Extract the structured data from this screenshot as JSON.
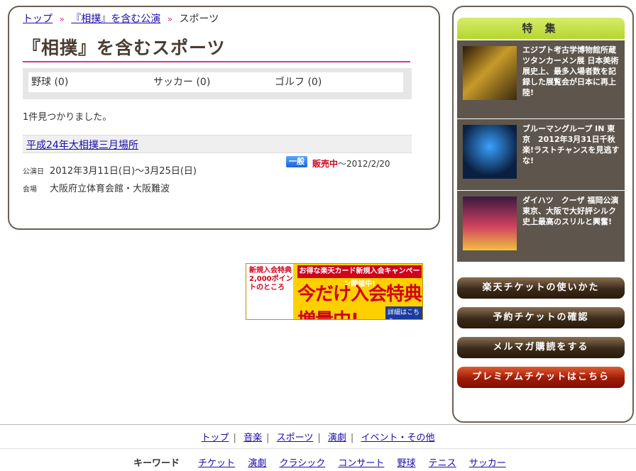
{
  "breadcrumb": {
    "items": [
      "トップ",
      "『相撲』を含む公演",
      "スポーツ"
    ],
    "separator": "»"
  },
  "page_title": "『相撲』を含むスポーツ",
  "categories": [
    {
      "label": "野球 (0)"
    },
    {
      "label": "サッカー (0)"
    },
    {
      "label": "ゴルフ (0)"
    }
  ],
  "result_count": "1件見つかりました。",
  "event": {
    "title": "平成24年大相撲三月場所",
    "date_label": "公演日",
    "date_value": "2012年3月11日(日)〜3月25日(日)",
    "venue_label": "会場",
    "venue_value": "大阪府立体育会館・大阪難波",
    "badge": "一般",
    "sale_status": "販売中",
    "sale_until": "〜2012/2/20"
  },
  "banner": {
    "left_text": "新規入会特典2,000ポイントのところ",
    "top_text": "お得な楽天カード新規入会キャンペーン開催中!",
    "main_text": "今だけ入会特典増量中!",
    "detail": "詳細はこちら"
  },
  "sidebar": {
    "feature_heading": "特 集",
    "features": [
      {
        "text": "エジプト考古学博物館所蔵 ツタンカーメン展 日本美術展史上、最多入場者数を記録した展覧会が日本に再上陸!"
      },
      {
        "text": "ブルーマングループ IN 東京　2012年3月31日千秋楽!ラストチャンスを見逃すな!"
      },
      {
        "text": "ダイハツ　クーザ 福岡公演 東京、大阪で大好評シルク史上最高のスリルと興奮!"
      }
    ],
    "buttons": [
      {
        "label": "楽天チケットの使いかた"
      },
      {
        "label": "予約チケットの確認"
      },
      {
        "label": "メルマガ購読をする"
      },
      {
        "label": "プレミアムチケットはこちら"
      }
    ]
  },
  "footer": {
    "nav": [
      "トップ",
      "音楽",
      "スポーツ",
      "演劇",
      "イベント・その他"
    ],
    "keyword_label": "キーワード",
    "keywords": [
      "チケット",
      "演劇",
      "クラシック",
      "コンサート",
      "野球",
      "テニス",
      "サッカー"
    ]
  }
}
